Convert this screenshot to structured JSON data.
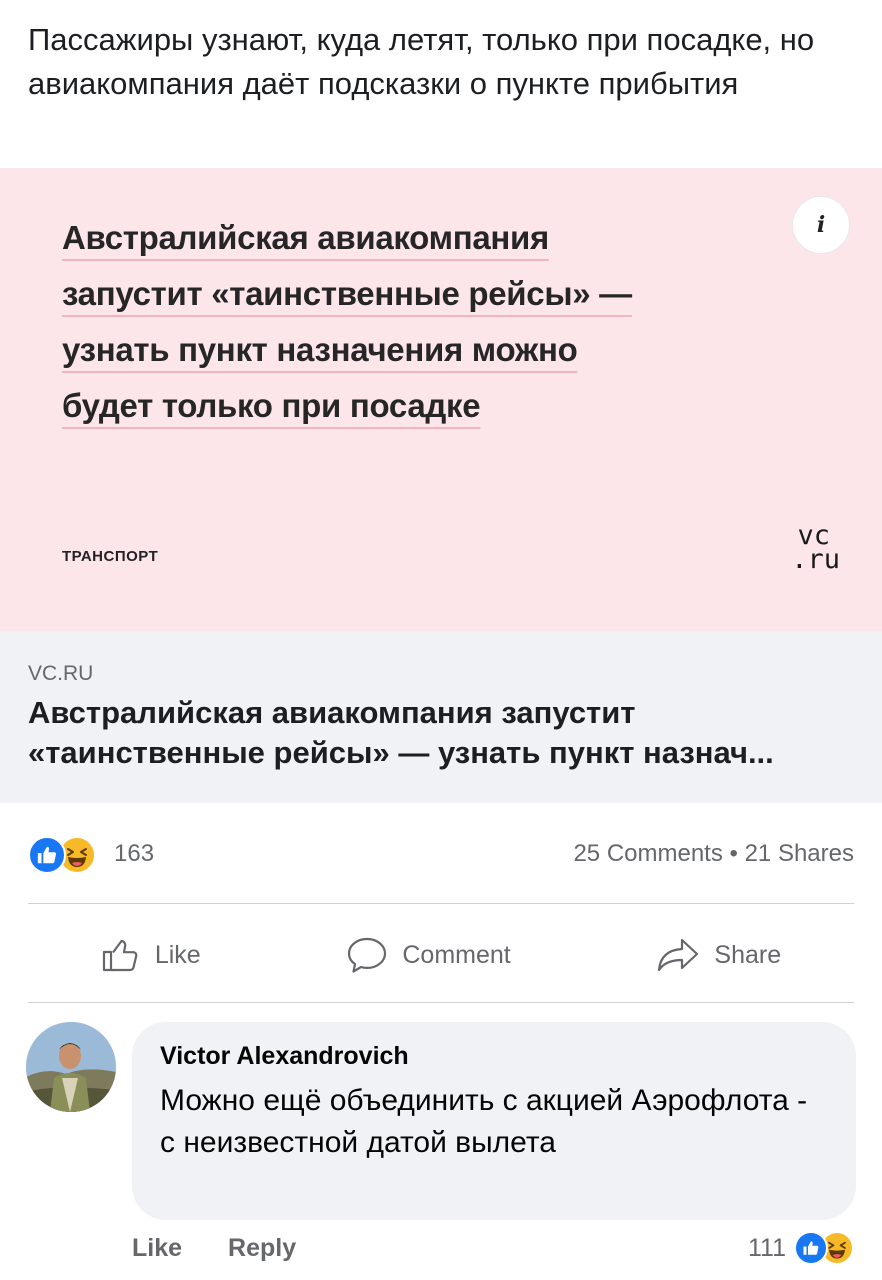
{
  "post": {
    "text": "Пассажиры узнают, куда летят, только при посадке, но авиакомпания даёт подсказки о пункте прибытия"
  },
  "link_card": {
    "image_headline_lines": [
      "Австралийская авиакомпания",
      "запустит «таинственные рейсы» —",
      "узнать пункт назначения можно",
      "будет только при посадке"
    ],
    "image_category": "ТРАНСПОРТ",
    "logo_line1": "vc",
    "logo_line2": ".ru",
    "info_icon_glyph": "i",
    "domain": "VC.RU",
    "title_line1": "Австралийская авиакомпания запустит",
    "title_line2": "«таинственные рейсы» — узнать пункт назнач..."
  },
  "reactions": {
    "icons": [
      "like-reaction-icon",
      "haha-reaction-icon"
    ],
    "count": "163",
    "stats": "25 Comments • 21 Shares"
  },
  "actions": {
    "like_label": "Like",
    "comment_label": "Comment",
    "share_label": "Share"
  },
  "comment": {
    "author": "Victor Alexandrovich",
    "text": "Можно ещё объединить с акцией Аэрофлота - с неизвестной датой вылета",
    "like_label": "Like",
    "reply_label": "Reply",
    "reaction_count": "111"
  },
  "colors": {
    "card_image_bg": "#fde6ea",
    "card_meta_bg": "#f0f2f5",
    "like_blue": "#1877f2",
    "haha_yellow": "#f7b928",
    "secondary_text": "#65676b"
  }
}
